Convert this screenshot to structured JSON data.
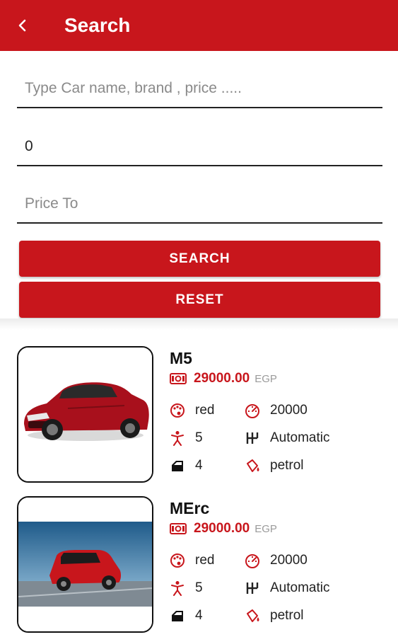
{
  "header": {
    "title": "Search"
  },
  "search": {
    "query_placeholder": "Type Car name, brand , price .....",
    "query_value": "",
    "price_from_value": "0",
    "price_to_placeholder": "Price To",
    "price_to_value": "",
    "search_label": "SEARCH",
    "reset_label": "RESET"
  },
  "colors": {
    "primary": "#c8161c",
    "text": "#111111",
    "muted": "#9a9a9a"
  },
  "results": [
    {
      "name": "M5",
      "price": "29000.00",
      "currency": "EGP",
      "color": "red",
      "mileage": "20000",
      "seats": "5",
      "transmission": "Automatic",
      "doors": "4",
      "fuel": "petrol"
    },
    {
      "name": "MErc",
      "price": "29000.00",
      "currency": "EGP",
      "color": "red",
      "mileage": "20000",
      "seats": "5",
      "transmission": "Automatic",
      "doors": "4",
      "fuel": "petrol"
    }
  ],
  "icons": {
    "back": "chevron-left-icon",
    "price": "money-icon",
    "color": "palette-icon",
    "mileage": "speedometer-icon",
    "seats": "person-icon",
    "transmission": "gearshift-icon",
    "doors": "car-door-icon",
    "fuel": "fuel-icon"
  }
}
